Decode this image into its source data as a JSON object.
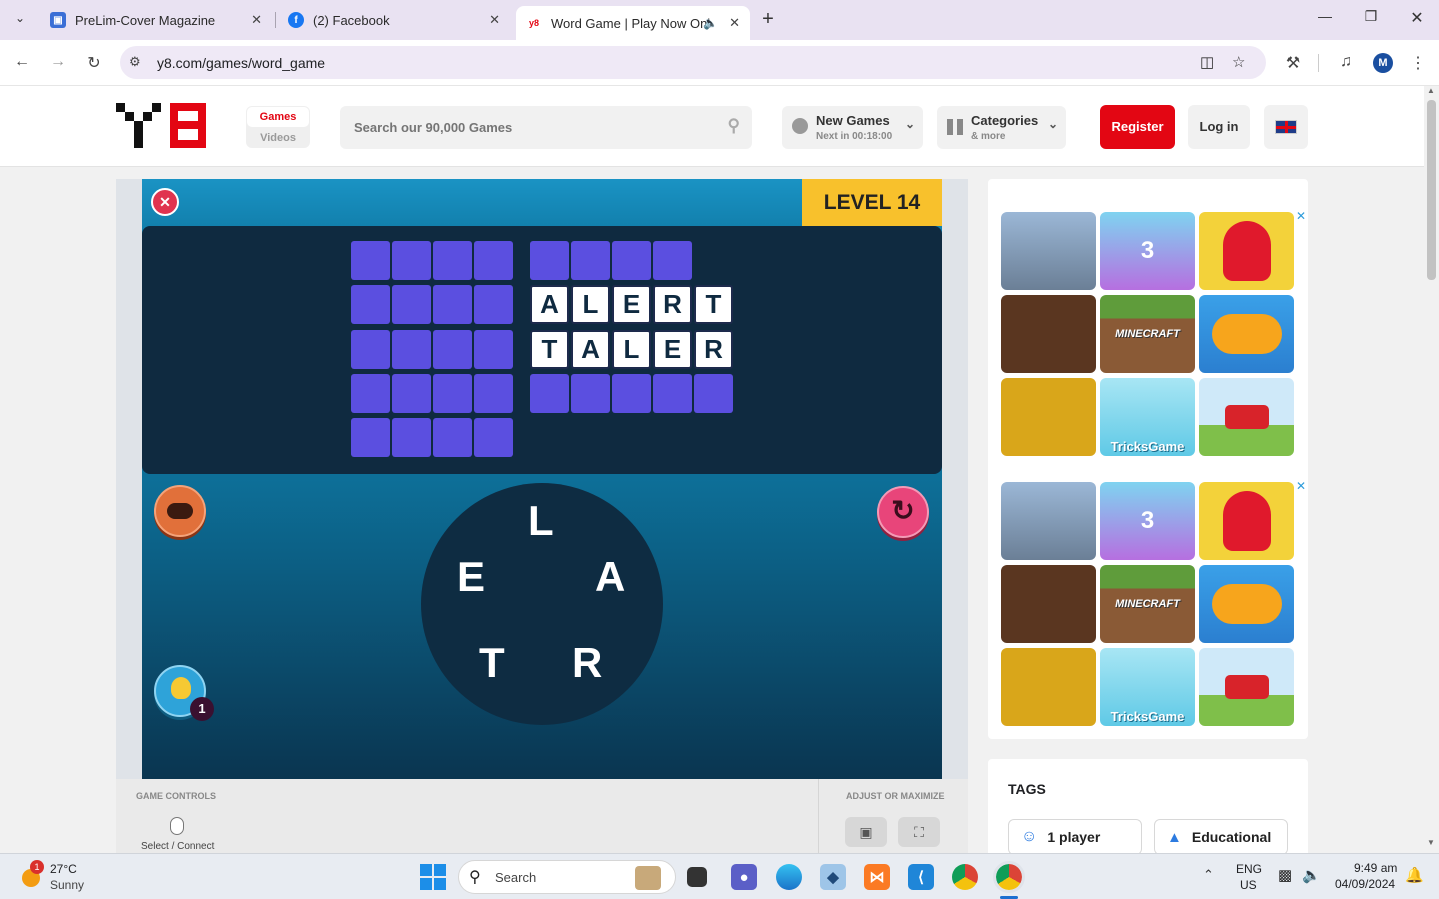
{
  "browser": {
    "tabs": [
      {
        "title": "PreLim-Cover Magazine",
        "icon": "form-icon",
        "active": false
      },
      {
        "title": "(2) Facebook",
        "icon": "facebook-icon",
        "active": false
      },
      {
        "title": "Word Game | Play Now Onl",
        "icon": "y8-icon",
        "active": true
      }
    ],
    "new_tab": "+",
    "url": "y8.com/games/word_game",
    "profile_initial": "M"
  },
  "site": {
    "nav": {
      "games": "Games",
      "videos": "Videos"
    },
    "search_placeholder": "Search our 90,000 Games",
    "new_games": {
      "title": "New Games",
      "subtitle": "Next in 00:18:00"
    },
    "categories": {
      "title": "Categories",
      "subtitle": "& more"
    },
    "register": "Register",
    "login": "Log in",
    "brand_color": "#e30613"
  },
  "game": {
    "level": "LEVEL 14",
    "placed_words": [
      [
        "A",
        "L",
        "E",
        "R",
        "T"
      ],
      [
        "T",
        "A",
        "L",
        "E",
        "R"
      ]
    ],
    "wheel_letters": {
      "top": "L",
      "left": "E",
      "right": "A",
      "bottom_left": "T",
      "bottom_right": "R"
    },
    "hint_count": "1",
    "colors": {
      "tile": "#5b4fe0",
      "board": "#0f2a40",
      "level_bg": "#f8c12c"
    }
  },
  "below_game": {
    "controls_title": "GAME CONTROLS",
    "controls_item": "Select / Connect",
    "adjust_title": "ADJUST OR MAXIMIZE"
  },
  "ads": {
    "thumbs": [
      "",
      "3",
      "",
      "",
      "MINECRAFT",
      "",
      "",
      "TricksGame",
      ""
    ]
  },
  "tags": {
    "title": "TAGS",
    "items": [
      "1 player",
      "Educational"
    ]
  },
  "taskbar": {
    "weather_temp": "27°C",
    "weather_desc": "Sunny",
    "weather_badge": "1",
    "search": "Search",
    "lang_top": "ENG",
    "lang_bottom": "US",
    "time": "9:49 am",
    "date": "04/09/2024"
  }
}
